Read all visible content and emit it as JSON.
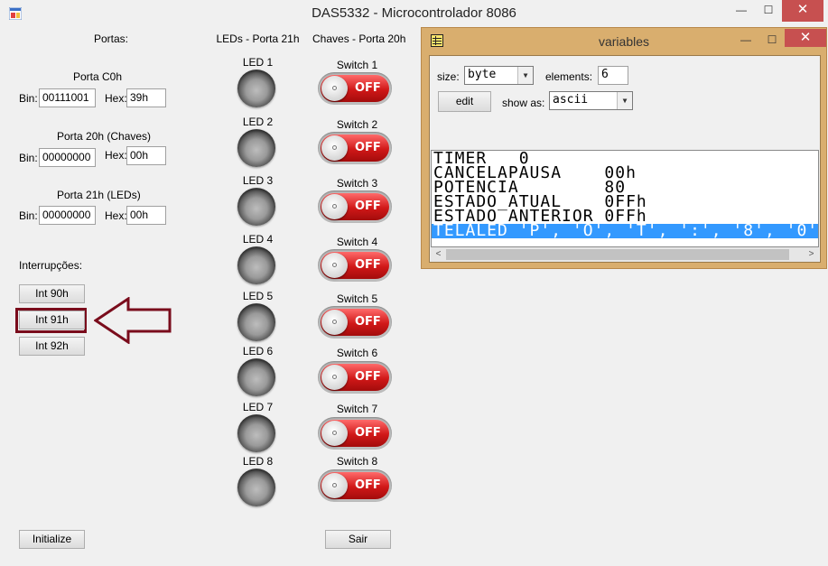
{
  "window": {
    "title": "DAS5332 - Microcontrolador 8086",
    "minimize_glyph": "—",
    "maximize_glyph": "☐",
    "close_glyph": "✕"
  },
  "ports": {
    "heading": "Portas:",
    "c0": {
      "label": "Porta C0h",
      "bin_label": "Bin:",
      "bin_value": "00111001",
      "hex_label": "Hex:",
      "hex_value": "39h"
    },
    "p20": {
      "label": "Porta 20h (Chaves)",
      "bin_label": "Bin:",
      "bin_value": "00000000",
      "hex_label": "Hex:",
      "hex_value": "00h"
    },
    "p21": {
      "label": "Porta 21h (LEDs)",
      "bin_label": "Bin:",
      "bin_value": "00000000",
      "hex_label": "Hex:",
      "hex_value": "00h"
    }
  },
  "interrupts": {
    "heading": "Interrupções:",
    "buttons": [
      "Int 90h",
      "Int 91h",
      "Int 92h"
    ]
  },
  "leds": {
    "heading": "LEDs - Porta 21h",
    "items": [
      "LED 1",
      "LED 2",
      "LED 3",
      "LED 4",
      "LED 5",
      "LED 6",
      "LED 7",
      "LED 8"
    ]
  },
  "switches": {
    "heading": "Chaves - Porta 20h",
    "items": [
      "Switch 1",
      "Switch 2",
      "Switch 3",
      "Switch 4",
      "Switch 5",
      "Switch 6",
      "Switch 7",
      "Switch 8"
    ],
    "state_text": "OFF"
  },
  "footer": {
    "initialize": "Initialize",
    "exit": "Sair"
  },
  "variables": {
    "title": "variables",
    "size_label": "size:",
    "size_value": "byte",
    "elements_label": "elements:",
    "elements_value": "6",
    "edit_label": "edit",
    "show_as_label": "show as:",
    "show_as_value": "ascii",
    "rows": [
      "TIMER   0",
      "CANCELAPAUSA    00h",
      "POTENCIA        80",
      "ESTADO_ATUAL    0FFh",
      "ESTADO_ANTERIOR 0FFh",
      "TELALED 'P', 'O', 'T', ':', '8', '0'"
    ],
    "selected_row": 5,
    "left_arrow": "<",
    "right_arrow": ">"
  },
  "colors": {
    "highlight_box": "#7a0c1c",
    "variables_frame": "#d9ae6e",
    "selection": "#3399ff",
    "switch_off": "#d01818"
  },
  "icons": {
    "app": "app-window-icon",
    "variables": "table-icon",
    "annotation": "left-arrow-outline"
  }
}
